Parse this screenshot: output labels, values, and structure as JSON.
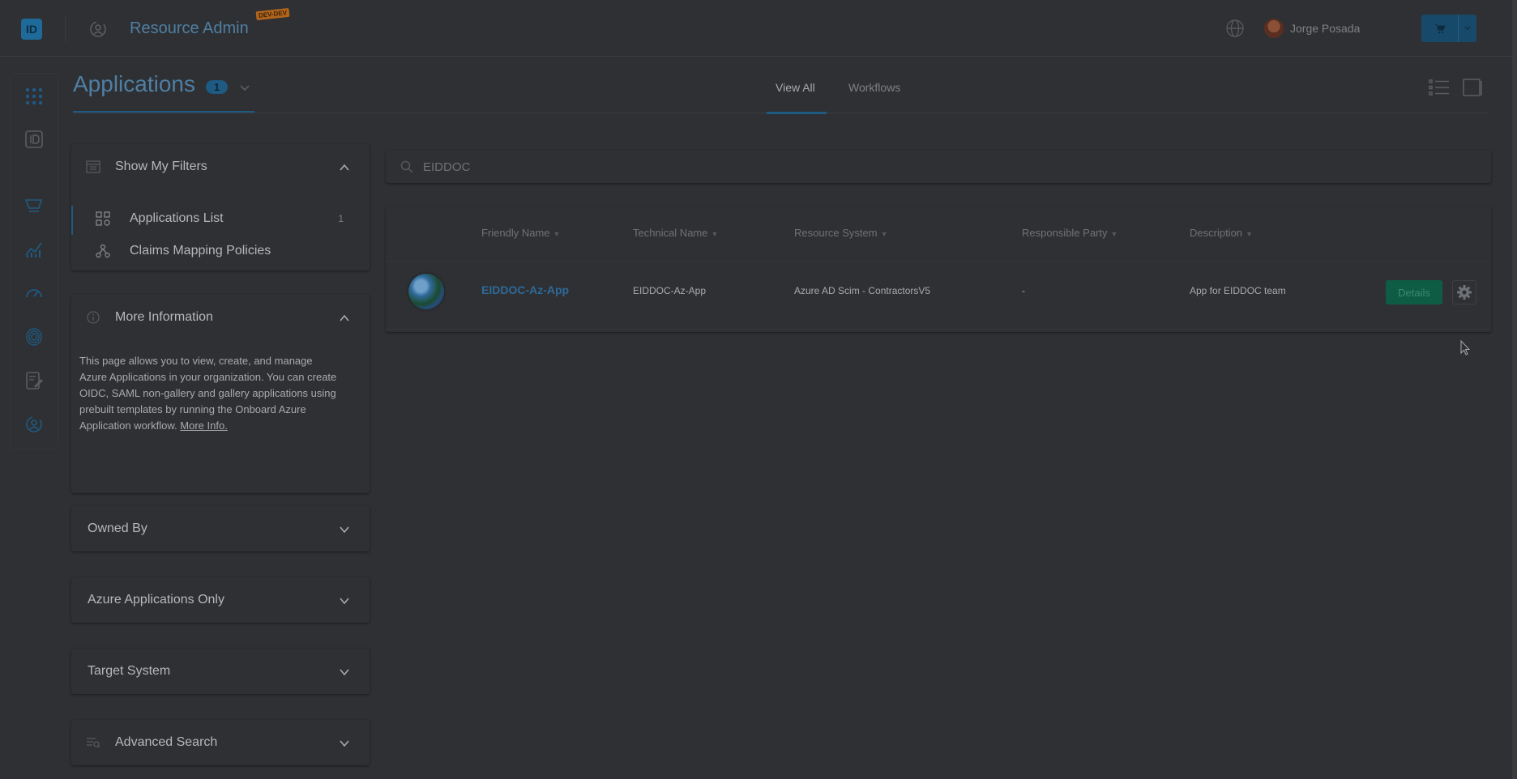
{
  "header": {
    "logo_text": "ID",
    "app_title": "Resource Admin",
    "env_badge": "DEV-DEV",
    "user_name": "Jorge Posada",
    "colors": {
      "brand": "#1e6a9a",
      "title": "#4f7fa3",
      "cart": "#174a6a",
      "background": "#2f3033"
    }
  },
  "rail": {
    "icons": [
      "apps-grid-icon",
      "id-card-icon",
      "cart-icon",
      "chart-icon",
      "gauge-icon",
      "fingerprint-icon",
      "edit-document-icon",
      "user-cycle-icon"
    ]
  },
  "page": {
    "title": "Applications",
    "count": "1",
    "tabs": [
      {
        "label": "View All",
        "active": true
      },
      {
        "label": "Workflows",
        "active": false
      }
    ]
  },
  "filters": {
    "show_my_filters": "Show My Filters",
    "items": [
      {
        "label": "Applications List",
        "count": "1"
      },
      {
        "label": "Claims Mapping Policies",
        "count": ""
      }
    ]
  },
  "more_info": {
    "title": "More Information",
    "text": "This page allows you to view, create, and manage Azure Applications in your organization. You can create OIDC, SAML non-gallery and gallery applications using prebuilt templates by running the Onboard Azure Application workflow. ",
    "link": "More Info."
  },
  "collapsed_panels": {
    "owned_by": "Owned By",
    "azure_only": "Azure Applications Only",
    "target_system": "Target System",
    "advanced_search": "Advanced Search"
  },
  "search": {
    "value": "EIDDOC"
  },
  "table": {
    "columns": [
      "Friendly Name",
      "Technical Name",
      "Resource System",
      "Responsible Party",
      "Description"
    ],
    "rows": [
      {
        "friendly_name": "EIDDOC-Az-App",
        "technical_name": "EIDDOC-Az-App",
        "resource_system": "Azure AD Scim - ContractorsV5",
        "responsible_party": "-",
        "description": "App for EIDDOC team",
        "details_label": "Details"
      }
    ]
  }
}
